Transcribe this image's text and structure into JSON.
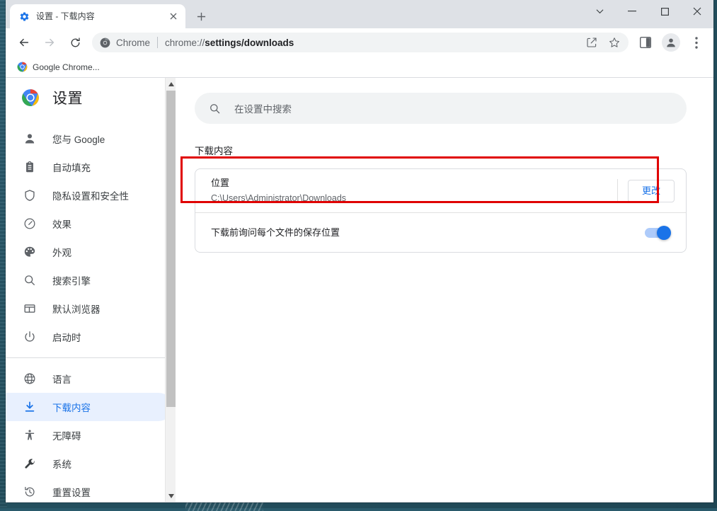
{
  "window": {
    "controls": {
      "tabsearch_label": "⌄",
      "minimize_label": "─",
      "maximize_label": "□",
      "close_label": "✕"
    }
  },
  "tabstrip": {
    "tabs": [
      {
        "title": "设置 - 下载内容",
        "favicon": "settings-gear-icon",
        "close_label": "✕"
      }
    ],
    "new_tab_label": "+"
  },
  "toolbar": {
    "back_label": "←",
    "forward_label": "→",
    "reload_label": "↻",
    "omnibox": {
      "icon": "chrome-logo-icon",
      "scheme_label": "Chrome",
      "url_prefix": "chrome://",
      "url_emphasis": "settings/downloads"
    },
    "share_icon": "share-icon",
    "bookmark_icon": "star-icon",
    "side_panel_icon": "side-panel-icon",
    "profile_icon": "profile-avatar-icon",
    "menu_icon": "three-dot-menu-icon"
  },
  "bookmarks_bar": {
    "items": [
      {
        "label": "Google Chrome...",
        "icon": "chrome-color-icon"
      }
    ]
  },
  "settings": {
    "header": {
      "title": "设置",
      "logo": "chrome-color-icon"
    },
    "search": {
      "placeholder": "在设置中搜索",
      "value": "",
      "icon": "search-icon"
    },
    "nav": {
      "group1": [
        {
          "label": "您与 Google",
          "icon": "person-icon",
          "selected": false
        },
        {
          "label": "自动填充",
          "icon": "clipboard-icon",
          "selected": false
        },
        {
          "label": "隐私设置和安全性",
          "icon": "shield-icon",
          "selected": false
        },
        {
          "label": "效果",
          "icon": "speedometer-icon",
          "selected": false
        },
        {
          "label": "外观",
          "icon": "palette-icon",
          "selected": false
        },
        {
          "label": "搜索引擎",
          "icon": "search-icon",
          "selected": false
        },
        {
          "label": "默认浏览器",
          "icon": "browser-window-icon",
          "selected": false
        },
        {
          "label": "启动时",
          "icon": "power-icon",
          "selected": false
        }
      ],
      "group2": [
        {
          "label": "语言",
          "icon": "globe-icon",
          "selected": false
        },
        {
          "label": "下载内容",
          "icon": "download-icon",
          "selected": true
        },
        {
          "label": "无障碍",
          "icon": "accessibility-icon",
          "selected": false
        },
        {
          "label": "系统",
          "icon": "wrench-icon",
          "selected": false
        },
        {
          "label": "重置设置",
          "icon": "restore-icon",
          "selected": false
        }
      ]
    },
    "scrollbar": {
      "up_arrow": "▲",
      "down_arrow": "▼"
    },
    "page": {
      "section_title": "下载内容",
      "rows": [
        {
          "label": "位置",
          "sublabel": "C:\\Users\\Administrator\\Downloads",
          "action_label": "更改",
          "control": "button"
        },
        {
          "label": "下载前询问每个文件的保存位置",
          "sublabel": "",
          "action_label": "",
          "control": "toggle",
          "toggle_on": true
        }
      ]
    }
  },
  "annotations": {
    "highlight_color": "#e00000"
  }
}
